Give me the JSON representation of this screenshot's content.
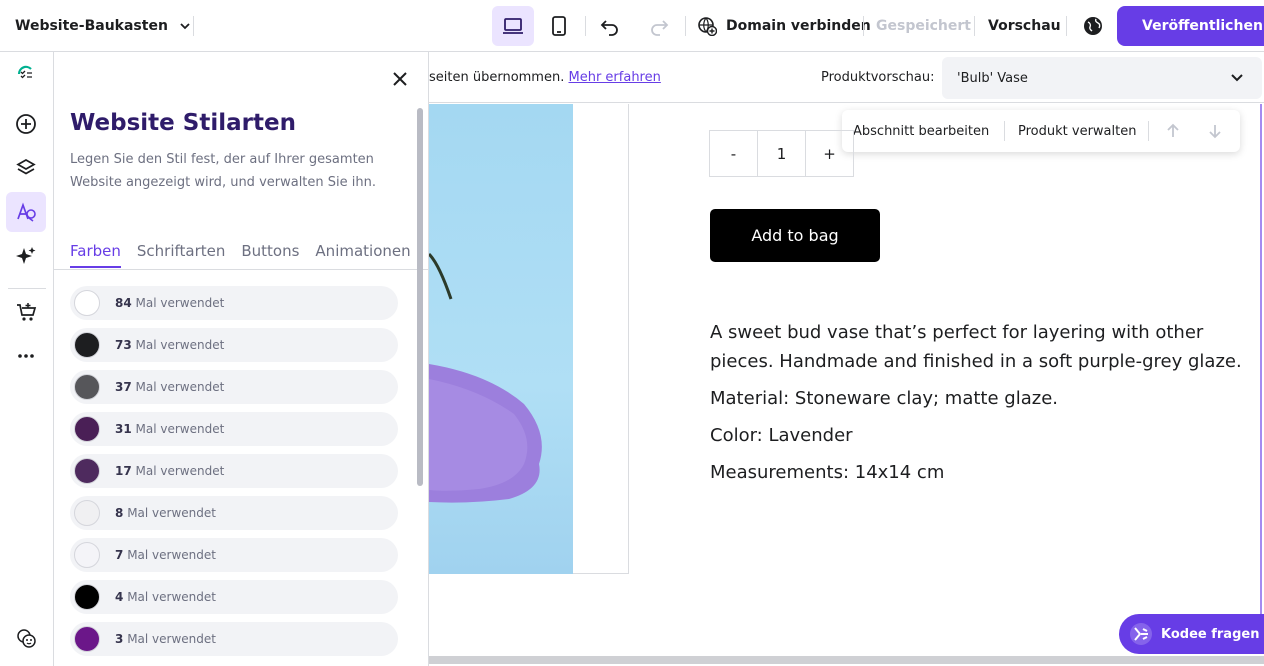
{
  "topbar": {
    "brand": "Website-Baukasten",
    "connect_domain": "Domain verbinden",
    "saved": "Gespeichert",
    "preview": "Vorschau",
    "publish": "Veröffentlichen"
  },
  "panel": {
    "title": "Website Stilarten",
    "description": "Legen Sie den Stil fest, der auf Ihrer gesamten Website angezeigt wird, und verwalten Sie ihn.",
    "tabs": [
      "Farben",
      "Schriftarten",
      "Buttons",
      "Animationen"
    ],
    "swatch_suffix": "Mal verwendet",
    "swatches": [
      {
        "count": "84",
        "color": "#ffffff"
      },
      {
        "count": "73",
        "color": "#1d1e20"
      },
      {
        "count": "37",
        "color": "#56565a"
      },
      {
        "count": "31",
        "color": "#4a1f56"
      },
      {
        "count": "17",
        "color": "#4e2a5e"
      },
      {
        "count": "8",
        "color": "#f0f0f2"
      },
      {
        "count": "7",
        "color": "#f4f4f8"
      },
      {
        "count": "4",
        "color": "#000000"
      },
      {
        "count": "3",
        "color": "#6b1789"
      }
    ]
  },
  "canvas": {
    "notice_text": "seiten übernommen.",
    "notice_link": "Mehr erfahren",
    "preview_label": "Produktvorschau:",
    "preview_value": "'Bulb' Vase",
    "qty_minus": "-",
    "qty_value": "1",
    "qty_plus": "+",
    "add_to_bag": "Add to bag",
    "description": [
      "A sweet bud vase that’s perfect for layering with other pieces. Handmade and finished in a soft purple-grey glaze.",
      "Material: Stoneware clay; matte glaze.",
      "Color: Lavender",
      "Measurements: 14x14 cm"
    ],
    "toolbar_edit": "Abschnitt bearbeiten",
    "toolbar_manage": "Produkt verwalten"
  },
  "kodee": "Kodee fragen",
  "colors": {
    "accent": "#673de6",
    "accent_light": "#ebe4ff"
  }
}
